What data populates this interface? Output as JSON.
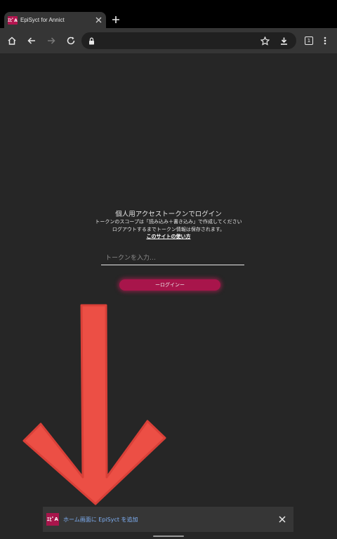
{
  "browser": {
    "tab": {
      "favicon_text": "ｴﾋﾟA",
      "title": "EpiSyct for Annict"
    },
    "tab_count": "1",
    "address": ""
  },
  "page": {
    "login_title": "個人用アクセストークンでログイン",
    "desc_line1": "トークンのスコープは「読み込み＋書き込み」で作成してください",
    "desc_line2": "ログアウトするまでトークン情報は保存されます。",
    "help_link": "このサイトの使い方",
    "token_placeholder": "トークンを入力…",
    "login_button": "ーログインー"
  },
  "install_banner": {
    "logo_text": "ｴﾋﾟA",
    "text": "ホーム画面に EpiSyct を追加"
  },
  "colors": {
    "accent": "#a8154b",
    "arrow": "#ec4f45",
    "background": "#262626"
  }
}
